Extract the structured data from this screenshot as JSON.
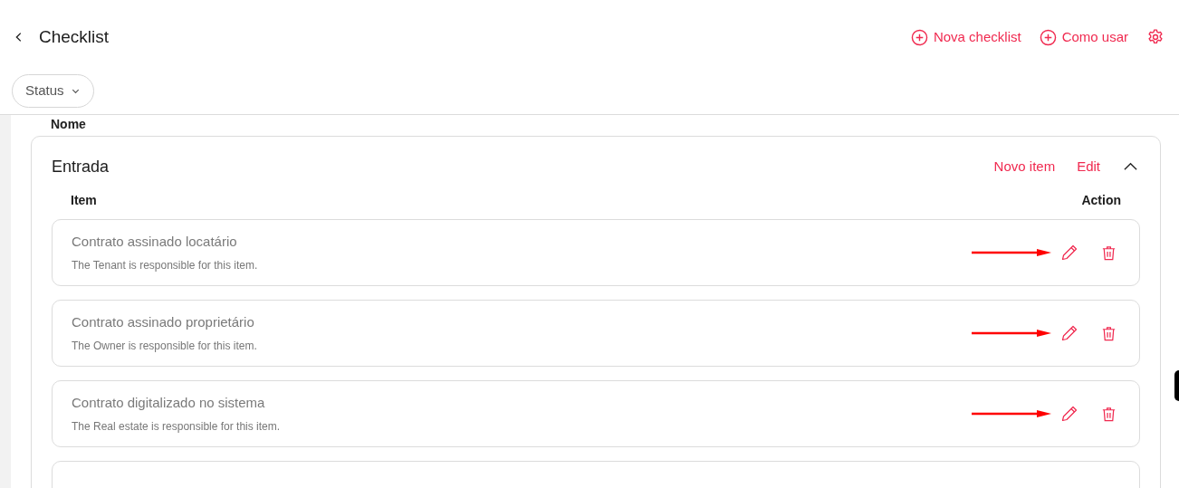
{
  "header": {
    "title": "Checklist",
    "actions": [
      {
        "kind": "add",
        "label": "Nova checklist"
      },
      {
        "kind": "add",
        "label": "Como usar"
      },
      {
        "kind": "settings"
      }
    ]
  },
  "filters": [
    {
      "label": "Status"
    }
  ],
  "list_heading": "Nome",
  "section": {
    "title": "Entrada",
    "expanded": true,
    "actions": [
      "Novo item",
      "Edit"
    ],
    "columns": [
      "Item",
      "Action"
    ],
    "items": [
      {
        "title": "Contrato assinado locatário",
        "note": "The Tenant is responsible for this item.",
        "annotated": true
      },
      {
        "title": "Contrato assinado proprietário",
        "note": "The Owner is responsible for this item.",
        "annotated": true
      },
      {
        "title": "Contrato digitalizado no sistema",
        "note": "The Real estate is responsible for this item.",
        "annotated": true
      },
      {
        "annotated": false
      }
    ]
  }
}
